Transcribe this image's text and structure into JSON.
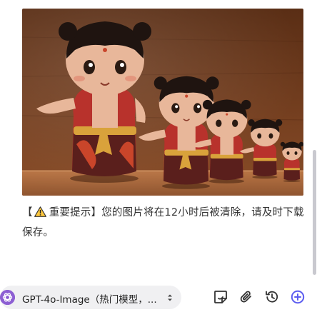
{
  "message": {
    "open_bracket": "【",
    "warning_icon": "warning-icon",
    "text": "重要提示】您的图片将在12小时后被清除，请及时下载保存。"
  },
  "image": {
    "description_icon": "nezha-dolls-photo",
    "colors": {
      "background": "#6b3a1f",
      "shelf": "#a8683b",
      "vest": "#b8322c",
      "pants": "#5a1f1c",
      "sash": "#d9a23b",
      "skin": "#e8b79a"
    }
  },
  "composer": {
    "model_label": "GPT-4o-Image（热门模型，...",
    "tools": [
      "sticker-icon",
      "attachment-icon",
      "history-icon",
      "add-chat-icon"
    ]
  },
  "colors": {
    "accent": "#5b5cf0",
    "model_logo": "#8d5fd3"
  }
}
